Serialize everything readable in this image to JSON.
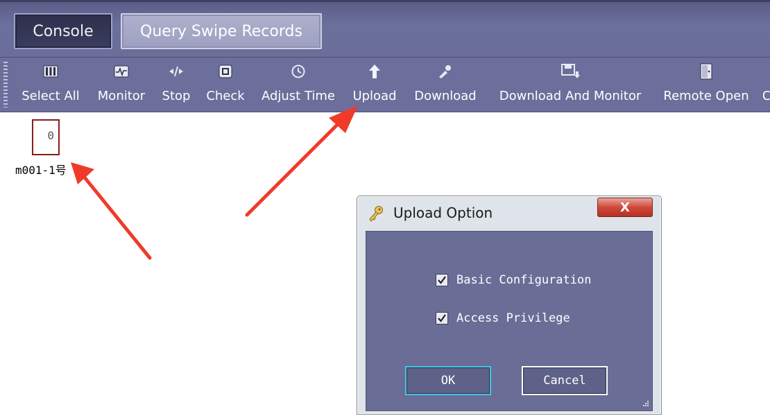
{
  "tabs": [
    {
      "label": "Console"
    },
    {
      "label": "Query Swipe Records"
    }
  ],
  "toolbar": {
    "items": [
      {
        "label": "Select All",
        "icon": "select-all-icon"
      },
      {
        "label": "Monitor",
        "icon": "monitor-icon"
      },
      {
        "label": "Stop",
        "icon": "stop-icon"
      },
      {
        "label": "Check",
        "icon": "check-icon"
      },
      {
        "label": "Adjust Time",
        "icon": "clock-icon"
      },
      {
        "label": "Upload",
        "icon": "upload-arrow-icon"
      },
      {
        "label": "Download",
        "icon": "download-icon"
      },
      {
        "label": "Download And Monitor",
        "icon": "download-monitor-icon"
      },
      {
        "label": "Remote Open",
        "icon": "door-icon"
      }
    ]
  },
  "device": {
    "count": "0",
    "name": "m001-1号"
  },
  "dialog": {
    "title": "Upload Option",
    "close_label": "X",
    "options": [
      {
        "label": "Basic Configuration",
        "checked": true
      },
      {
        "label": "Access Privilege",
        "checked": true
      }
    ],
    "ok_label": "OK",
    "cancel_label": "Cancel"
  },
  "colors": {
    "toolbar_bg": "#6c6f9b",
    "dialog_body_bg": "#6a6e97",
    "arrow": "#f03a2a",
    "device_border": "#8b1a1a",
    "ok_focus": "#45c3e6",
    "close_button": "#c9402f"
  }
}
